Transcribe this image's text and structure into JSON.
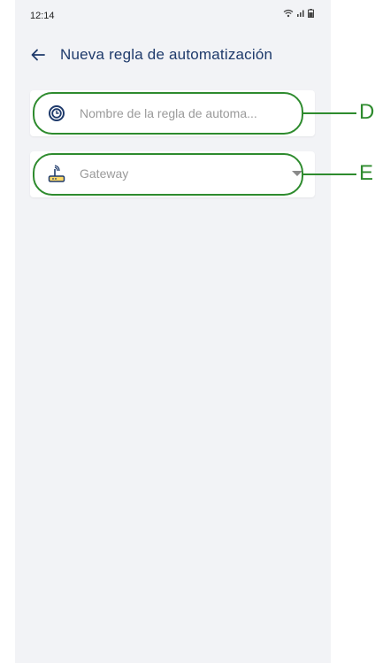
{
  "status_bar": {
    "time": "12:14",
    "icons": [
      "wifi-icon",
      "signal-icon",
      "battery-icon"
    ]
  },
  "app_bar": {
    "back_icon": "arrow-left-icon",
    "title": "Nueva regla de automatización"
  },
  "form": {
    "name_field": {
      "icon": "timer-icon",
      "placeholder": "Nombre de la regla de automa...",
      "value": ""
    },
    "gateway_field": {
      "icon": "router-icon",
      "placeholder": "Gateway",
      "selected": ""
    }
  },
  "annotations": {
    "d_label": "D",
    "e_label": "E",
    "color": "#2e8b2e"
  },
  "colors": {
    "title": "#1e3a6b",
    "background": "#f2f3f6",
    "card": "#ffffff"
  }
}
